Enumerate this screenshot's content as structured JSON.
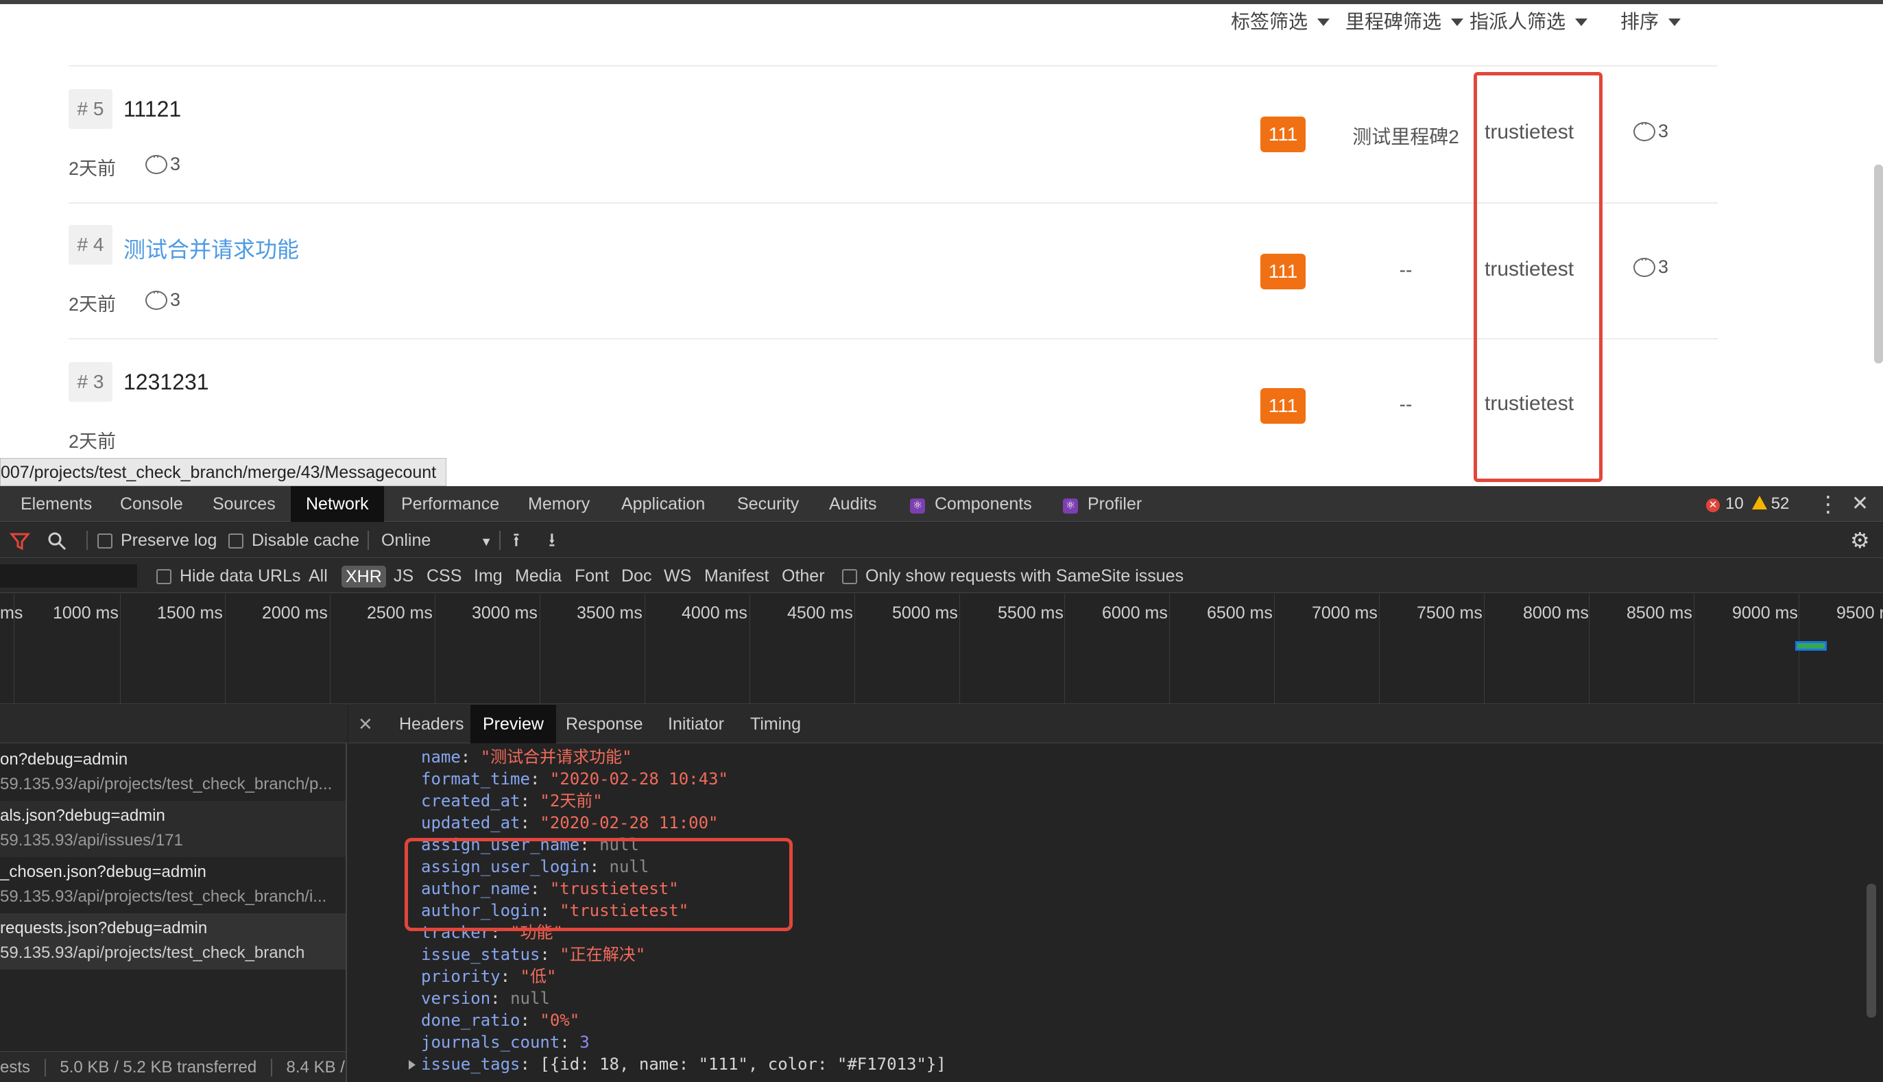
{
  "filters": {
    "labels": "标签筛选",
    "milestone": "里程碑筛选",
    "assignee": "指派人筛选",
    "sort": "排序"
  },
  "issues": [
    {
      "number": "# 5",
      "title": "11121",
      "time": "2天前",
      "comments": "3",
      "tag": "111",
      "milestone": "测试里程碑2",
      "assignee": "trustietest",
      "right_comments": "3"
    },
    {
      "number": "# 4",
      "title": "测试合并请求功能",
      "time": "2天前",
      "comments": "3",
      "tag": "111",
      "milestone": "--",
      "assignee": "trustietest",
      "right_comments": "3"
    },
    {
      "number": "# 3",
      "title": "1231231",
      "time": "2天前",
      "comments": "",
      "tag": "111",
      "milestone": "--",
      "assignee": "trustietest",
      "right_comments": ""
    }
  ],
  "status_url": "007/projects/test_check_branch/merge/43/Messagecount",
  "devtools": {
    "tabs": [
      "Elements",
      "Console",
      "Sources",
      "Network",
      "Performance",
      "Memory",
      "Application",
      "Security",
      "Audits",
      "Components",
      "Profiler"
    ],
    "active_tab": "Network",
    "errors": "10",
    "warnings": "52",
    "toolbar": {
      "preserve_log": "Preserve log",
      "disable_cache": "Disable cache",
      "throttle": "Online"
    },
    "filterbar": {
      "hide_data_urls": "Hide data URLs",
      "types": [
        "All",
        "XHR",
        "JS",
        "CSS",
        "Img",
        "Media",
        "Font",
        "Doc",
        "WS",
        "Manifest",
        "Other"
      ],
      "active_type": "XHR",
      "samesite": "Only show requests with SameSite issues"
    },
    "timeline_ticks": [
      "ms",
      "1000 ms",
      "1500 ms",
      "2000 ms",
      "2500 ms",
      "3000 ms",
      "3500 ms",
      "4000 ms",
      "4500 ms",
      "5000 ms",
      "5500 ms",
      "6000 ms",
      "6500 ms",
      "7000 ms",
      "7500 ms",
      "8000 ms",
      "8500 ms",
      "9000 ms",
      "9500 r"
    ],
    "requests": [
      {
        "name": "on?debug=admin",
        "path": "59.135.93/api/projects/test_check_branch/p..."
      },
      {
        "name": "als.json?debug=admin",
        "path": "59.135.93/api/issues/171"
      },
      {
        "name": "_chosen.json?debug=admin",
        "path": "59.135.93/api/projects/test_check_branch/i..."
      },
      {
        "name": "requests.json?debug=admin",
        "path": "59.135.93/api/projects/test_check_branch"
      }
    ],
    "footer": {
      "requests": "ests",
      "transferred": "5.0 KB / 5.2 KB transferred",
      "resources": "8.4 KB / !"
    },
    "detail_tabs": [
      "Headers",
      "Preview",
      "Response",
      "Initiator",
      "Timing"
    ],
    "active_detail_tab": "Preview",
    "preview": {
      "name": "\"测试合并请求功能\"",
      "format_time": "\"2020-02-28 10:43\"",
      "created_at": "\"2天前\"",
      "updated_at": "\"2020-02-28 11:00\"",
      "assign_user_name": "null",
      "assign_user_login": "null",
      "author_name": "\"trustietest\"",
      "author_login": "\"trustietest\"",
      "tracker": "\"功能\"",
      "issue_status": "\"正在解决\"",
      "priority": "\"低\"",
      "version": "null",
      "done_ratio": "\"0%\"",
      "journals_count": "3",
      "issue_tags": "[{id: 18, name: \"111\", color: \"#F17013\"}]"
    }
  },
  "colors": {
    "tag": "#f17013",
    "highlight": "#e2463a",
    "link": "#4d9ae3"
  }
}
